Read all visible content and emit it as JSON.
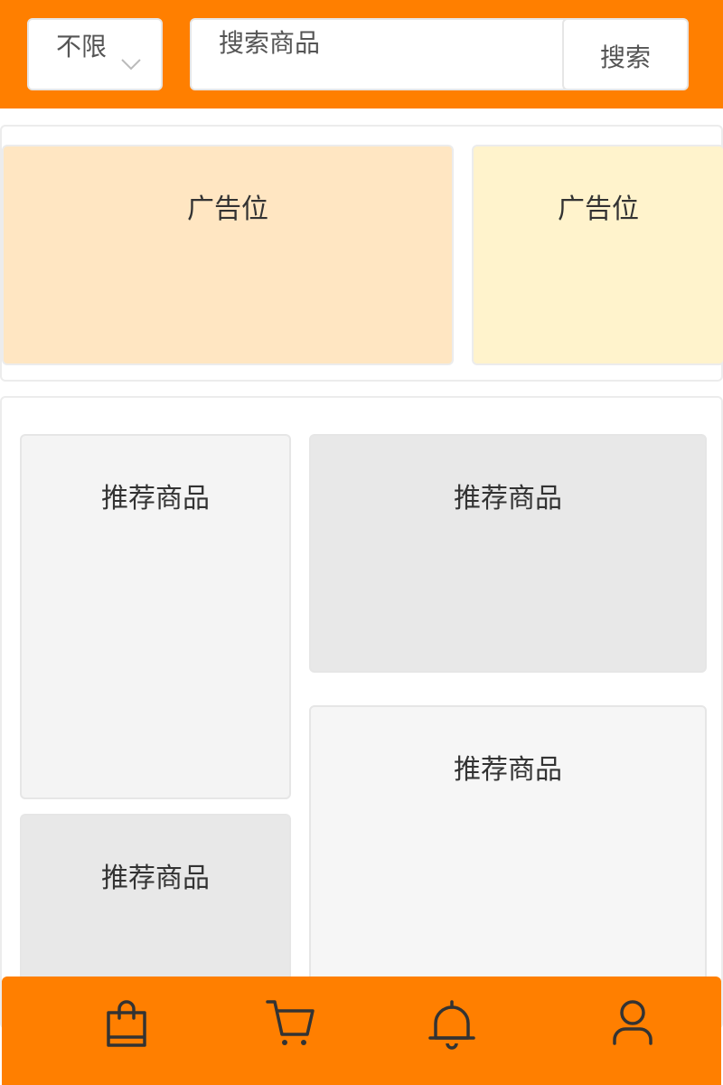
{
  "header": {
    "filter_label": "不限",
    "search_placeholder": "搜索商品",
    "search_button": "搜索",
    "brand_color": "#ff7f00"
  },
  "ads": [
    {
      "label": "广告位",
      "color": "#ffe6c2"
    },
    {
      "label": "广告位",
      "color": "#fff3cc"
    }
  ],
  "recommendations": [
    {
      "label": "推荐商品"
    },
    {
      "label": "推荐商品"
    },
    {
      "label": "推荐商品"
    },
    {
      "label": "推荐商品"
    }
  ],
  "bottom_nav": [
    {
      "icon": "shopping-bag-icon"
    },
    {
      "icon": "cart-icon"
    },
    {
      "icon": "bell-icon"
    },
    {
      "icon": "user-icon"
    }
  ]
}
